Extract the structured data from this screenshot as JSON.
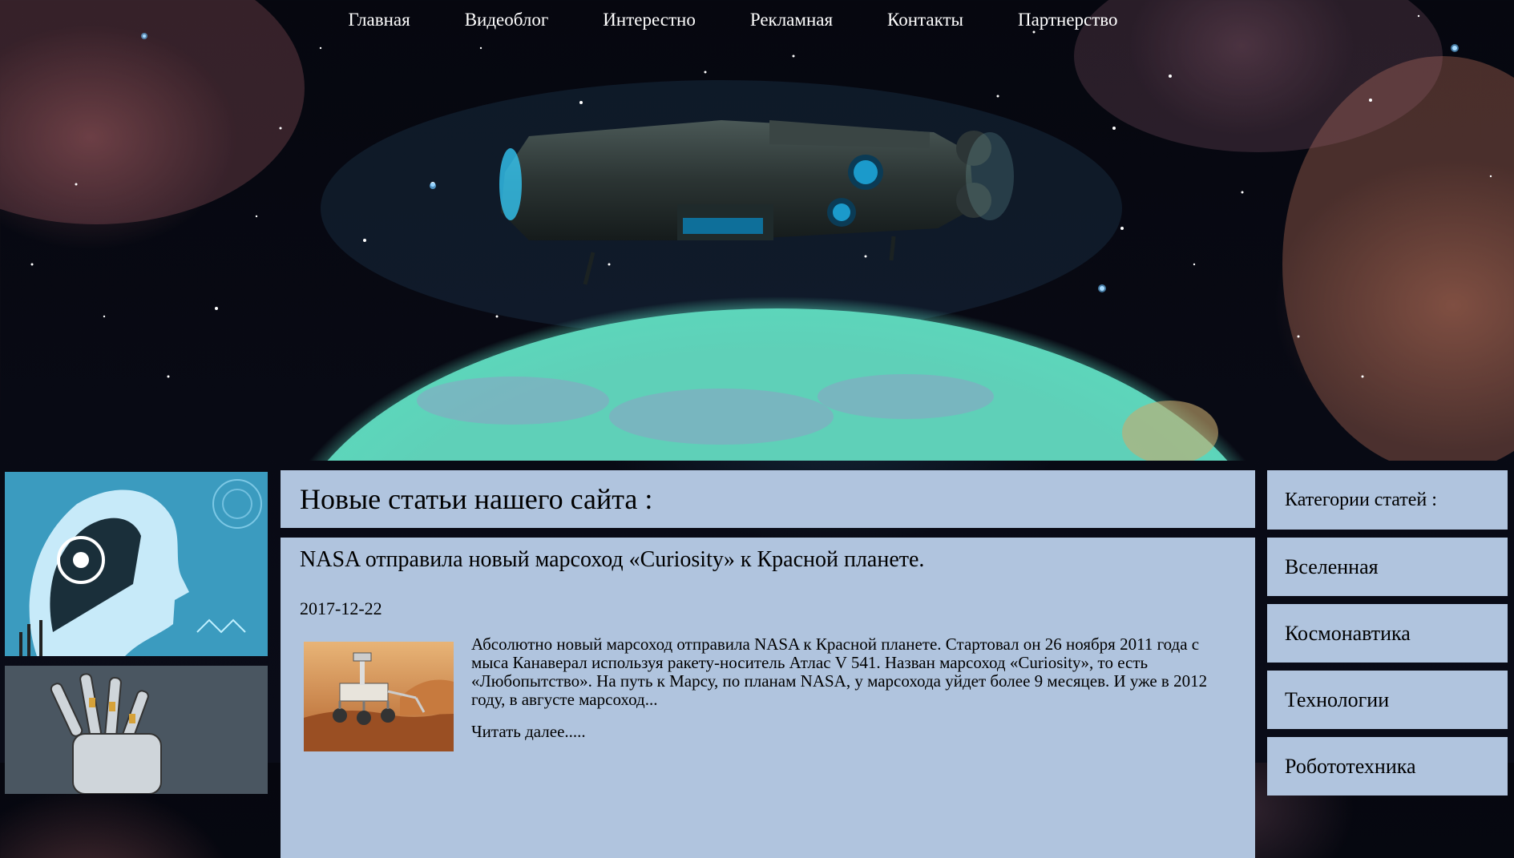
{
  "nav": {
    "items": [
      {
        "label": "Главная"
      },
      {
        "label": "Видеоблог"
      },
      {
        "label": "Интерестно"
      },
      {
        "label": "Рекламная"
      },
      {
        "label": "Контакты"
      },
      {
        "label": "Партнерство"
      }
    ]
  },
  "main": {
    "headline": "Новые статьи нашего сайта :",
    "article": {
      "title": "NASA отправила новый марсоход «Curiosity» к Красной планете.",
      "date": "2017-12-22",
      "excerpt": "Абсолютно новый марсоход отправила NASA к Красной планете. Стартовал он 26 ноября 2011 года с мыса Канаверал используя ракету-носитель Атлас V 541. Назван марсоход «Curiosity», то есть «Любопытство». На путь к Марсу, по планам NASA, у марсохода уйдет более 9 месяцев. И уже в 2012 году, в августе марсоход...",
      "read_more": "Читать далее....."
    }
  },
  "sidebar": {
    "title": "Категории статей :",
    "categories": [
      {
        "label": "Вселенная"
      },
      {
        "label": "Космонавтика"
      },
      {
        "label": "Технологии"
      },
      {
        "label": "Робототехника"
      }
    ]
  },
  "colors": {
    "panel": "#b0c4de",
    "nav_text": "#ffffff"
  },
  "icons": {
    "hero": "spaceship-over-planet-image",
    "left_thumbs": [
      "android-head-image",
      "robot-hand-image"
    ],
    "article": "mars-rover-image"
  }
}
